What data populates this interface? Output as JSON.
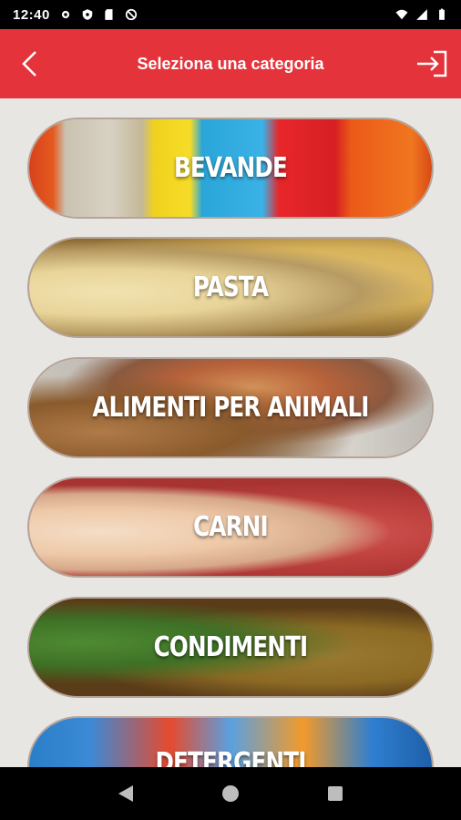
{
  "status_bar": {
    "time": "12:40",
    "icons": [
      "gear-icon",
      "shield-icon",
      "sd-card-icon",
      "no-disturb-icon",
      "wifi-icon",
      "signal-icon",
      "battery-icon"
    ]
  },
  "app_bar": {
    "title": "Seleziona una categoria",
    "back_icon": "chevron-left-icon",
    "login_icon": "login-icon",
    "color": "#e5333b"
  },
  "categories": [
    {
      "label": "BEVANDE"
    },
    {
      "label": "PASTA"
    },
    {
      "label": "ALIMENTI PER ANIMALI"
    },
    {
      "label": "CARNI"
    },
    {
      "label": "CONDIMENTI"
    },
    {
      "label": "DETERGENTI"
    }
  ],
  "nav_bar": {
    "buttons": [
      "back-triangle-icon",
      "home-circle-icon",
      "recents-square-icon"
    ]
  }
}
